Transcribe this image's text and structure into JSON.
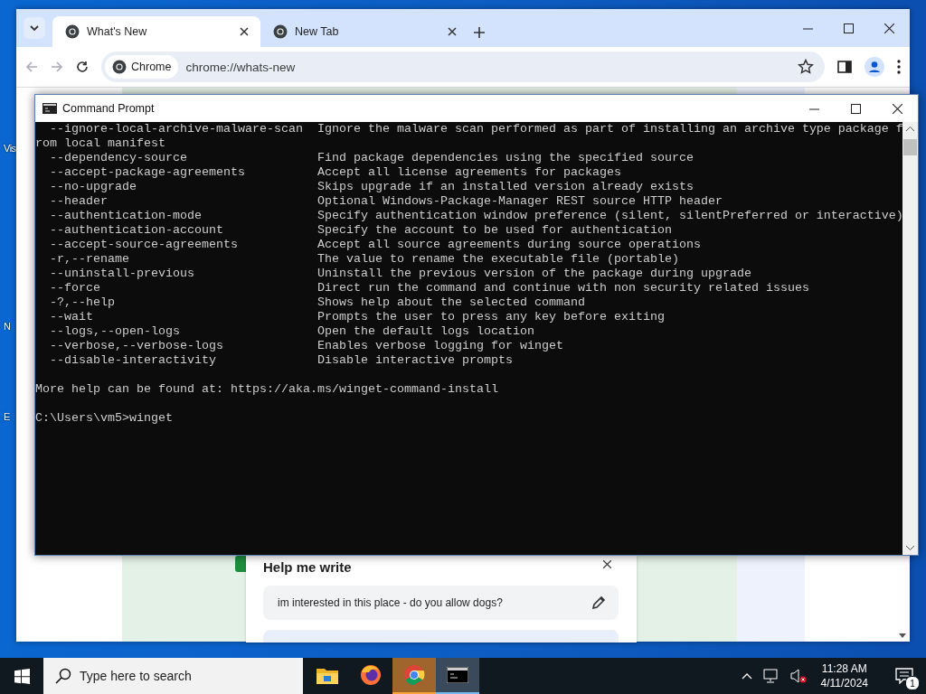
{
  "desktop": {
    "icon_labels": [
      "Vis",
      "N",
      "E"
    ]
  },
  "browser": {
    "tabs": [
      {
        "title": "What's New",
        "selected": true
      },
      {
        "title": "New Tab",
        "selected": false
      }
    ],
    "address_bar": {
      "chip": "Chrome",
      "url": "chrome://whats-new"
    },
    "help_me_write": {
      "title": "Help me write",
      "prompt": "im interested in this place - do you allow dogs?"
    }
  },
  "command_prompt": {
    "title": "Command Prompt",
    "lines": [
      {
        "kind": "option",
        "option": "--ignore-local-archive-malware-scan",
        "description": "Ignore the malware scan performed as part of installing an archive type package f"
      },
      {
        "kind": "text",
        "text": "rom local manifest"
      },
      {
        "kind": "option",
        "option": "--dependency-source",
        "description": "Find package dependencies using the specified source"
      },
      {
        "kind": "option",
        "option": "--accept-package-agreements",
        "description": "Accept all license agreements for packages"
      },
      {
        "kind": "option",
        "option": "--no-upgrade",
        "description": "Skips upgrade if an installed version already exists"
      },
      {
        "kind": "option",
        "option": "--header",
        "description": "Optional Windows-Package-Manager REST source HTTP header"
      },
      {
        "kind": "option",
        "option": "--authentication-mode",
        "description": "Specify authentication window preference (silent, silentPreferred or interactive)"
      },
      {
        "kind": "option",
        "option": "--authentication-account",
        "description": "Specify the account to be used for authentication"
      },
      {
        "kind": "option",
        "option": "--accept-source-agreements",
        "description": "Accept all source agreements during source operations"
      },
      {
        "kind": "option",
        "option": "-r,--rename",
        "description": "The value to rename the executable file (portable)"
      },
      {
        "kind": "option",
        "option": "--uninstall-previous",
        "description": "Uninstall the previous version of the package during upgrade"
      },
      {
        "kind": "option",
        "option": "--force",
        "description": "Direct run the command and continue with non security related issues"
      },
      {
        "kind": "option",
        "option": "-?,--help",
        "description": "Shows help about the selected command"
      },
      {
        "kind": "option",
        "option": "--wait",
        "description": "Prompts the user to press any key before exiting"
      },
      {
        "kind": "option",
        "option": "--logs,--open-logs",
        "description": "Open the default logs location"
      },
      {
        "kind": "option",
        "option": "--verbose,--verbose-logs",
        "description": "Enables verbose logging for winget"
      },
      {
        "kind": "option",
        "option": "--disable-interactivity",
        "description": "Disable interactive prompts"
      },
      {
        "kind": "blank"
      },
      {
        "kind": "text",
        "text": "More help can be found at: https://aka.ms/winget-command-install"
      },
      {
        "kind": "blank"
      },
      {
        "kind": "text",
        "text": "C:\\Users\\vm5>winget"
      }
    ]
  },
  "taskbar": {
    "search_placeholder": "Type here to search",
    "apps": [
      {
        "kind": "explorer",
        "attention": false,
        "selected": false
      },
      {
        "kind": "firefox",
        "attention": false,
        "selected": false
      },
      {
        "kind": "chrome",
        "attention": true,
        "selected": false
      },
      {
        "kind": "terminal",
        "attention": false,
        "selected": true
      }
    ],
    "time": "11:28 AM",
    "date": "4/11/2024",
    "notifications": "1"
  }
}
